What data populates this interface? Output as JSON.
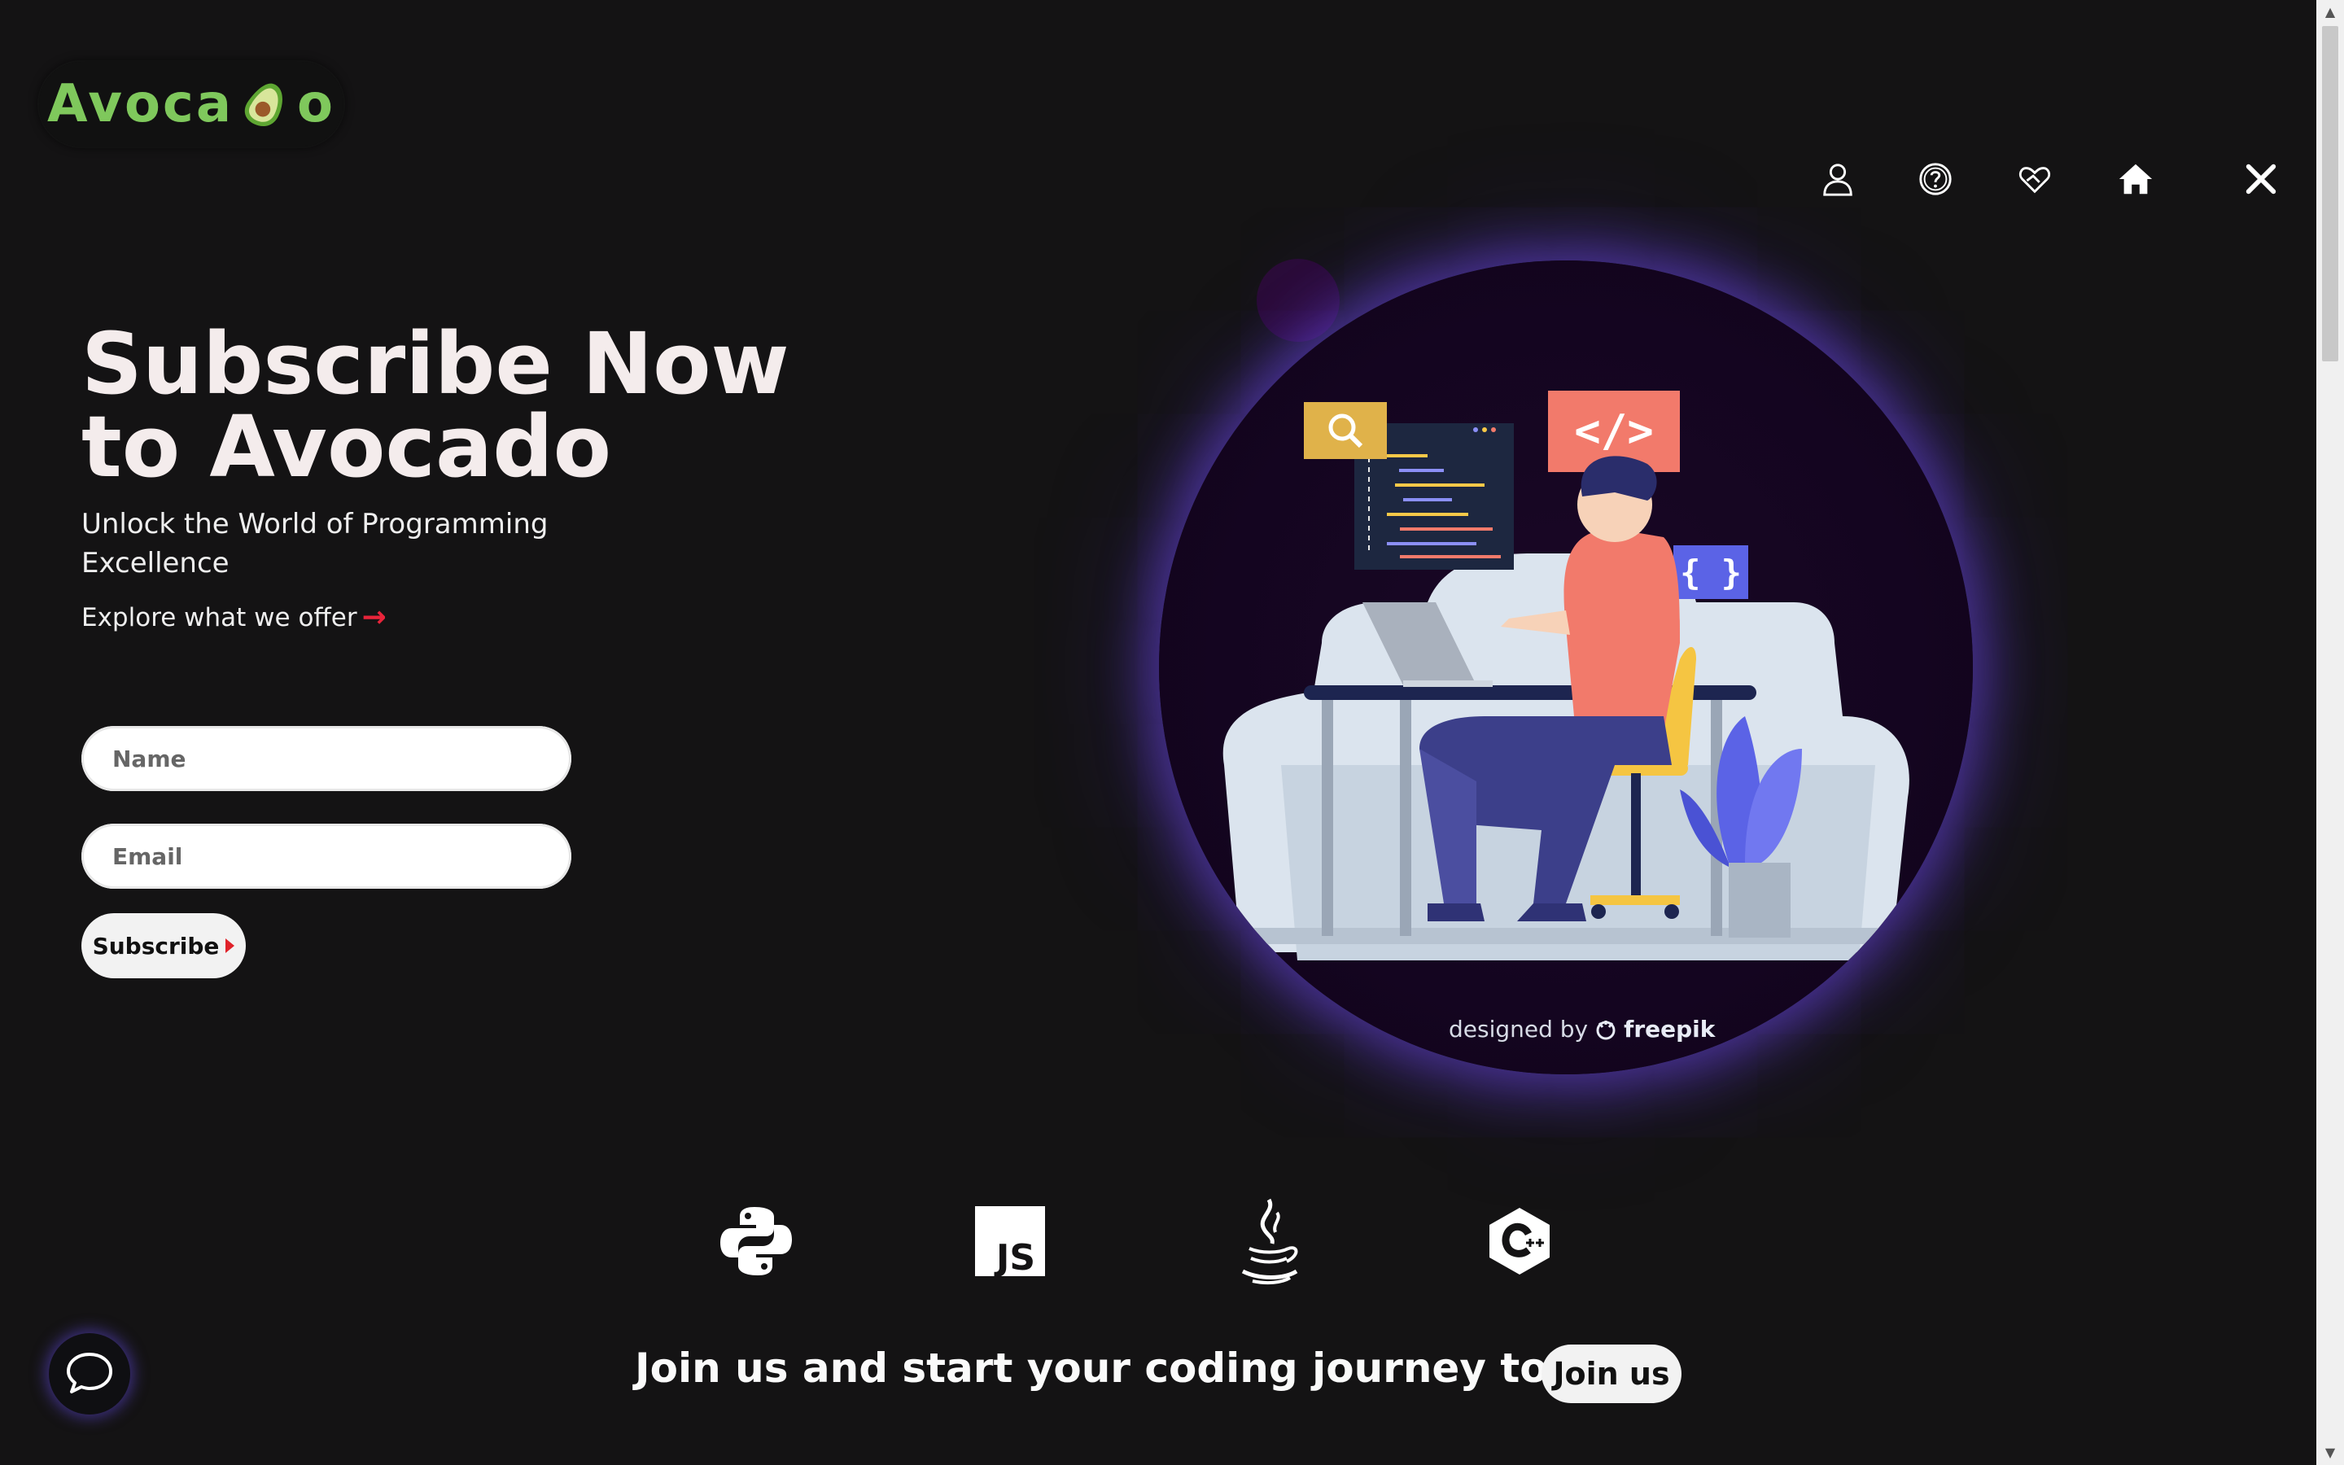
{
  "brand": {
    "logo_pre": "Avoca",
    "logo_post": "o",
    "accent": "#7fc85c"
  },
  "nav": {
    "icons": [
      "user-icon",
      "help-icon",
      "handshake-heart-icon",
      "home-icon",
      "close-icon"
    ]
  },
  "hero": {
    "title_line1": "Subscribe Now",
    "title_line2": "to Avocado",
    "subtitle": "Unlock the World of Programming Excellence",
    "explore_link": "Explore what we offer",
    "explore_arrow": "→"
  },
  "form": {
    "name_placeholder": "Name",
    "email_placeholder": "Email",
    "subscribe_label": "Subscribe"
  },
  "illustration": {
    "code_badge": "</>",
    "braces_badge": "{ }",
    "credit_prefix": "designed by",
    "credit_brand": "freepik"
  },
  "languages": [
    "python-icon",
    "javascript-icon",
    "java-icon",
    "cplusplus-icon"
  ],
  "js_badge": "JS",
  "cta": {
    "text": "Join us and start your coding journey today.",
    "button": "Join us"
  },
  "colors": {
    "background": "#141314",
    "glow": "#6c48e6",
    "arrow": "#e8243a"
  }
}
